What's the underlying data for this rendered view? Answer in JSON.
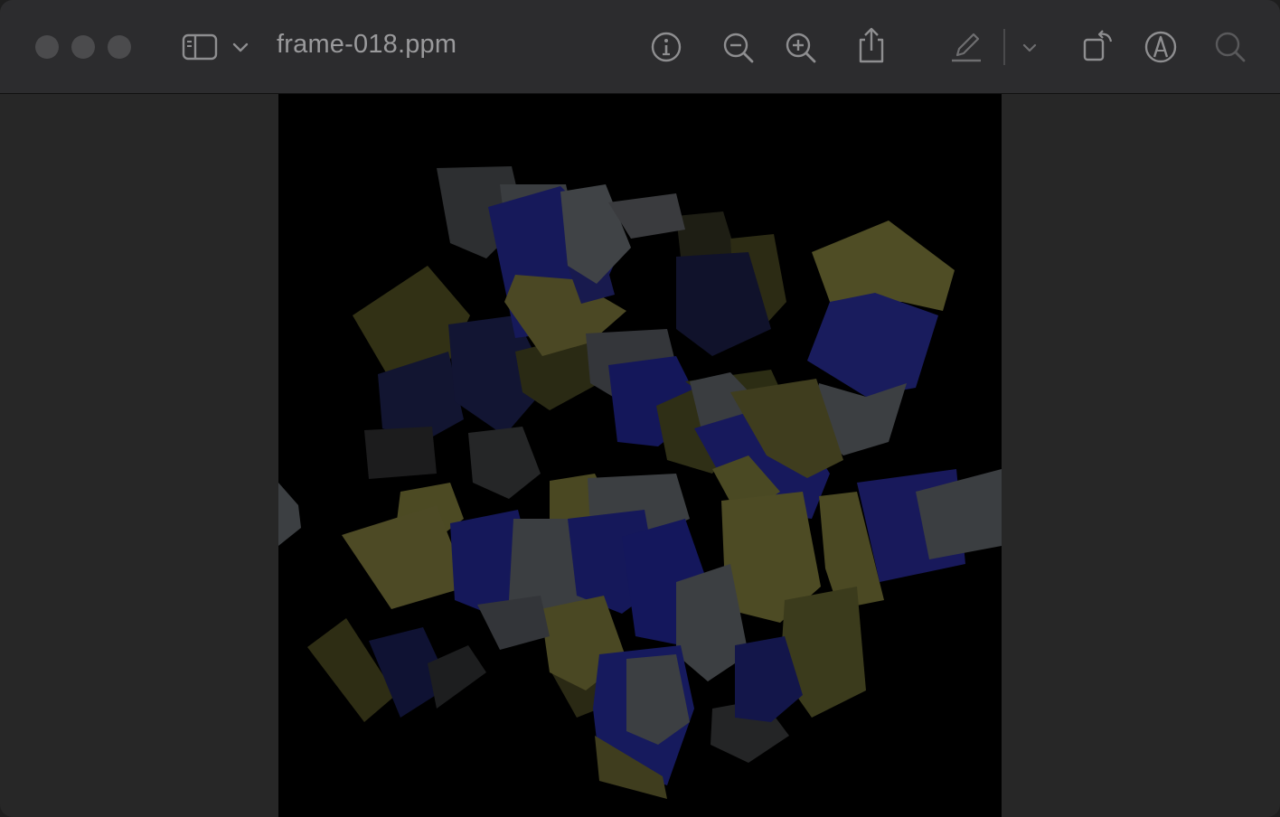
{
  "window": {
    "title": "frame-018.ppm",
    "traffic_lights": [
      "close",
      "minimize",
      "zoom"
    ]
  },
  "toolbar": {
    "icons": [
      "sidebar-icon",
      "chevron-down-icon",
      "info-icon",
      "zoom-out-icon",
      "zoom-in-icon",
      "share-icon",
      "markup-pencil-icon",
      "chevron-down-icon",
      "rotate-icon",
      "annotate-icon",
      "search-icon"
    ]
  },
  "colors": {
    "yellow": "#4c4a24",
    "blue": "#17195a",
    "gray": "#3c3f42",
    "background": "#000000",
    "chrome": "#2c2c2e"
  }
}
